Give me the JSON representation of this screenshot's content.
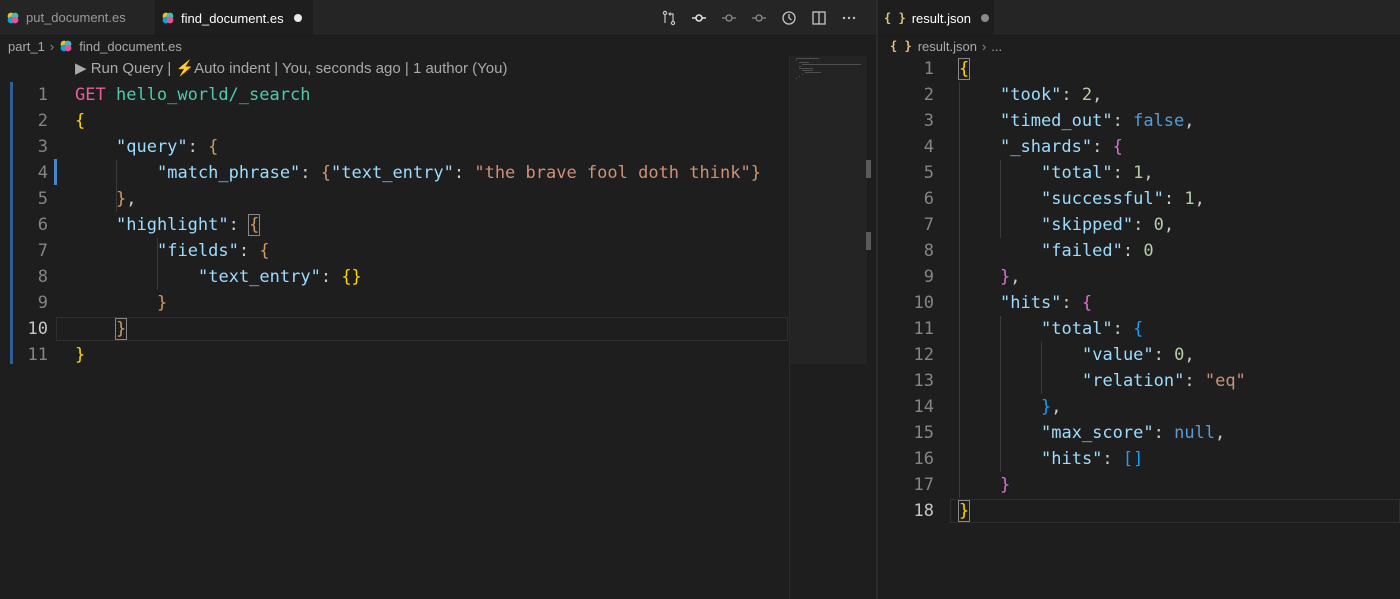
{
  "left_editor": {
    "tabs": [
      {
        "label": "put_document.es",
        "active": false,
        "dirty": false
      },
      {
        "label": "find_document.es",
        "active": true,
        "dirty": true
      }
    ],
    "breadcrumb": {
      "folder": "part_1",
      "file": "find_document.es"
    },
    "codelens": "▶ Run Query | ⚡Auto indent | You, seconds ago | 1 author (You)",
    "current_line": "10",
    "lines": [
      {
        "n": "1",
        "indent": 0,
        "tokens": [
          [
            "kw",
            "GET"
          ],
          [
            "pun",
            " "
          ],
          [
            "path",
            "hello_world/_search"
          ]
        ]
      },
      {
        "n": "2",
        "indent": 0,
        "tokens": [
          [
            "b1",
            "{"
          ]
        ]
      },
      {
        "n": "3",
        "indent": 1,
        "tokens": [
          [
            "key",
            "\"query\""
          ],
          [
            "pun",
            ": "
          ],
          [
            "bo",
            "{"
          ]
        ]
      },
      {
        "n": "4",
        "indent": 2,
        "tokens": [
          [
            "key",
            "\"match_phrase\""
          ],
          [
            "pun",
            ": "
          ],
          [
            "bo",
            "{"
          ],
          [
            "key",
            "\"text_entry\""
          ],
          [
            "pun",
            ": "
          ],
          [
            "str",
            "\"the brave fool doth think\""
          ],
          [
            "bo",
            "}"
          ]
        ]
      },
      {
        "n": "5",
        "indent": 1,
        "tokens": [
          [
            "bo",
            "}"
          ],
          [
            "pun",
            ","
          ]
        ]
      },
      {
        "n": "6",
        "indent": 1,
        "tokens": [
          [
            "key",
            "\"highlight\""
          ],
          [
            "pun",
            ": "
          ],
          [
            "bo bm",
            "{"
          ]
        ]
      },
      {
        "n": "7",
        "indent": 2,
        "tokens": [
          [
            "key",
            "\"fields\""
          ],
          [
            "pun",
            ": "
          ],
          [
            "bo",
            "{"
          ]
        ]
      },
      {
        "n": "8",
        "indent": 3,
        "tokens": [
          [
            "key",
            "\"text_entry\""
          ],
          [
            "pun",
            ": "
          ],
          [
            "b1",
            "{}"
          ]
        ]
      },
      {
        "n": "9",
        "indent": 2,
        "tokens": [
          [
            "bo",
            "}"
          ]
        ]
      },
      {
        "n": "10",
        "indent": 1,
        "tokens": [
          [
            "bo bm",
            "}"
          ]
        ]
      },
      {
        "n": "11",
        "indent": 0,
        "tokens": [
          [
            "b1",
            "}"
          ]
        ]
      }
    ]
  },
  "right_editor": {
    "tabs": [
      {
        "label": "result.json",
        "active": true,
        "dirty": true
      }
    ],
    "breadcrumb": {
      "file": "result.json",
      "rest": "..."
    },
    "current_line": "18",
    "lines": [
      {
        "n": "1",
        "indent": 0,
        "tokens": [
          [
            "b1 bm",
            "{"
          ]
        ]
      },
      {
        "n": "2",
        "indent": 1,
        "tokens": [
          [
            "key",
            "\"took\""
          ],
          [
            "pun",
            ": "
          ],
          [
            "num",
            "2"
          ],
          [
            "pun",
            ","
          ]
        ]
      },
      {
        "n": "3",
        "indent": 1,
        "tokens": [
          [
            "key",
            "\"timed_out\""
          ],
          [
            "pun",
            ": "
          ],
          [
            "lit",
            "false"
          ],
          [
            "pun",
            ","
          ]
        ]
      },
      {
        "n": "4",
        "indent": 1,
        "tokens": [
          [
            "key",
            "\"_shards\""
          ],
          [
            "pun",
            ": "
          ],
          [
            "b2",
            "{"
          ]
        ]
      },
      {
        "n": "5",
        "indent": 2,
        "tokens": [
          [
            "key",
            "\"total\""
          ],
          [
            "pun",
            ": "
          ],
          [
            "num",
            "1"
          ],
          [
            "pun",
            ","
          ]
        ]
      },
      {
        "n": "6",
        "indent": 2,
        "tokens": [
          [
            "key",
            "\"successful\""
          ],
          [
            "pun",
            ": "
          ],
          [
            "num",
            "1"
          ],
          [
            "pun",
            ","
          ]
        ]
      },
      {
        "n": "7",
        "indent": 2,
        "tokens": [
          [
            "key",
            "\"skipped\""
          ],
          [
            "pun",
            ": "
          ],
          [
            "num",
            "0"
          ],
          [
            "pun",
            ","
          ]
        ]
      },
      {
        "n": "8",
        "indent": 2,
        "tokens": [
          [
            "key",
            "\"failed\""
          ],
          [
            "pun",
            ": "
          ],
          [
            "num",
            "0"
          ]
        ]
      },
      {
        "n": "9",
        "indent": 1,
        "tokens": [
          [
            "b2",
            "}"
          ],
          [
            "pun",
            ","
          ]
        ]
      },
      {
        "n": "10",
        "indent": 1,
        "tokens": [
          [
            "key",
            "\"hits\""
          ],
          [
            "pun",
            ": "
          ],
          [
            "b2",
            "{"
          ]
        ]
      },
      {
        "n": "11",
        "indent": 2,
        "tokens": [
          [
            "key",
            "\"total\""
          ],
          [
            "pun",
            ": "
          ],
          [
            "b3",
            "{"
          ]
        ]
      },
      {
        "n": "12",
        "indent": 3,
        "tokens": [
          [
            "key",
            "\"value\""
          ],
          [
            "pun",
            ": "
          ],
          [
            "num",
            "0"
          ],
          [
            "pun",
            ","
          ]
        ]
      },
      {
        "n": "13",
        "indent": 3,
        "tokens": [
          [
            "key",
            "\"relation\""
          ],
          [
            "pun",
            ": "
          ],
          [
            "str",
            "\"eq\""
          ]
        ]
      },
      {
        "n": "14",
        "indent": 2,
        "tokens": [
          [
            "b3",
            "}"
          ],
          [
            "pun",
            ","
          ]
        ]
      },
      {
        "n": "15",
        "indent": 2,
        "tokens": [
          [
            "key",
            "\"max_score\""
          ],
          [
            "pun",
            ": "
          ],
          [
            "lit",
            "null"
          ],
          [
            "pun",
            ","
          ]
        ]
      },
      {
        "n": "16",
        "indent": 2,
        "tokens": [
          [
            "key",
            "\"hits\""
          ],
          [
            "pun",
            ": "
          ],
          [
            "b3",
            "[]"
          ]
        ]
      },
      {
        "n": "17",
        "indent": 1,
        "tokens": [
          [
            "b2",
            "}"
          ]
        ]
      },
      {
        "n": "18",
        "indent": 0,
        "tokens": [
          [
            "b1 bm",
            "}"
          ]
        ]
      }
    ]
  },
  "colors": {
    "accent_gutter": "#2f5d95",
    "background": "#1e1e1e",
    "tabbar": "#252526"
  },
  "icons": {
    "es_file": "elastic-logo-icon",
    "json_file": "json-braces-icon",
    "toolbar": [
      "git-compare-icon",
      "git-commit-icon",
      "go-previous-change-icon",
      "go-next-change-icon",
      "timeline-icon",
      "split-editor-icon",
      "more-actions-icon"
    ]
  }
}
